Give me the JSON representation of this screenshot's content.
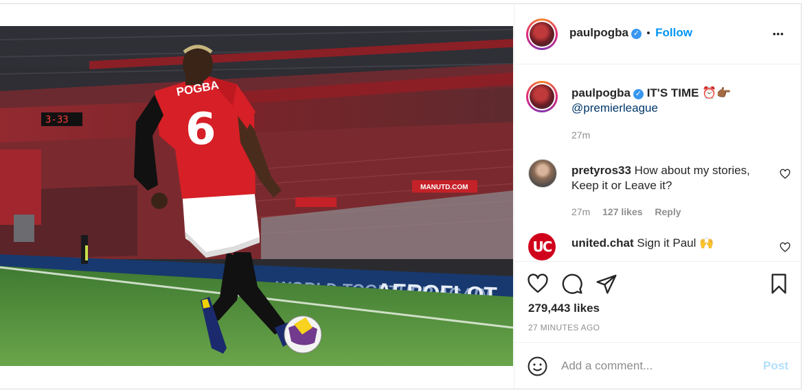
{
  "post": {
    "author": "paulpogba",
    "follow_label": "Follow",
    "separator": "•",
    "more_label": "•••",
    "photo_alt": "Player in red number 6 shirt dribbling ball near corner of empty stadium",
    "jersey_name": "POGBA",
    "jersey_number": "6",
    "board_text": "AEROFLOT",
    "caption_text": "IT'S TIME ⏰👉🏾",
    "caption_mention": "@premierleague",
    "caption_time": "27m",
    "likes": "279,443 likes",
    "time_ago": "27 MINUTES AGO"
  },
  "comments": [
    {
      "user": "pretyros33",
      "text": "How about my stories, Keep it or Leave it?",
      "time": "27m",
      "likes": "127 likes",
      "reply_label": "Reply"
    },
    {
      "user": "united.chat",
      "text": "Sign it Paul 🙌",
      "avatar_text": "UC"
    }
  ],
  "add_comment": {
    "placeholder": "Add a comment...",
    "post_label": "Post"
  },
  "colors": {
    "accent": "#0095f6",
    "verified": "#3897f0",
    "muted": "#8e8e8e",
    "post_disabled": "#b2dffc",
    "jersey_red": "#d61f26"
  },
  "icons": [
    "heart-icon",
    "comment-icon",
    "share-icon",
    "bookmark-icon",
    "emoji-icon",
    "more-icon",
    "verified-icon"
  ]
}
